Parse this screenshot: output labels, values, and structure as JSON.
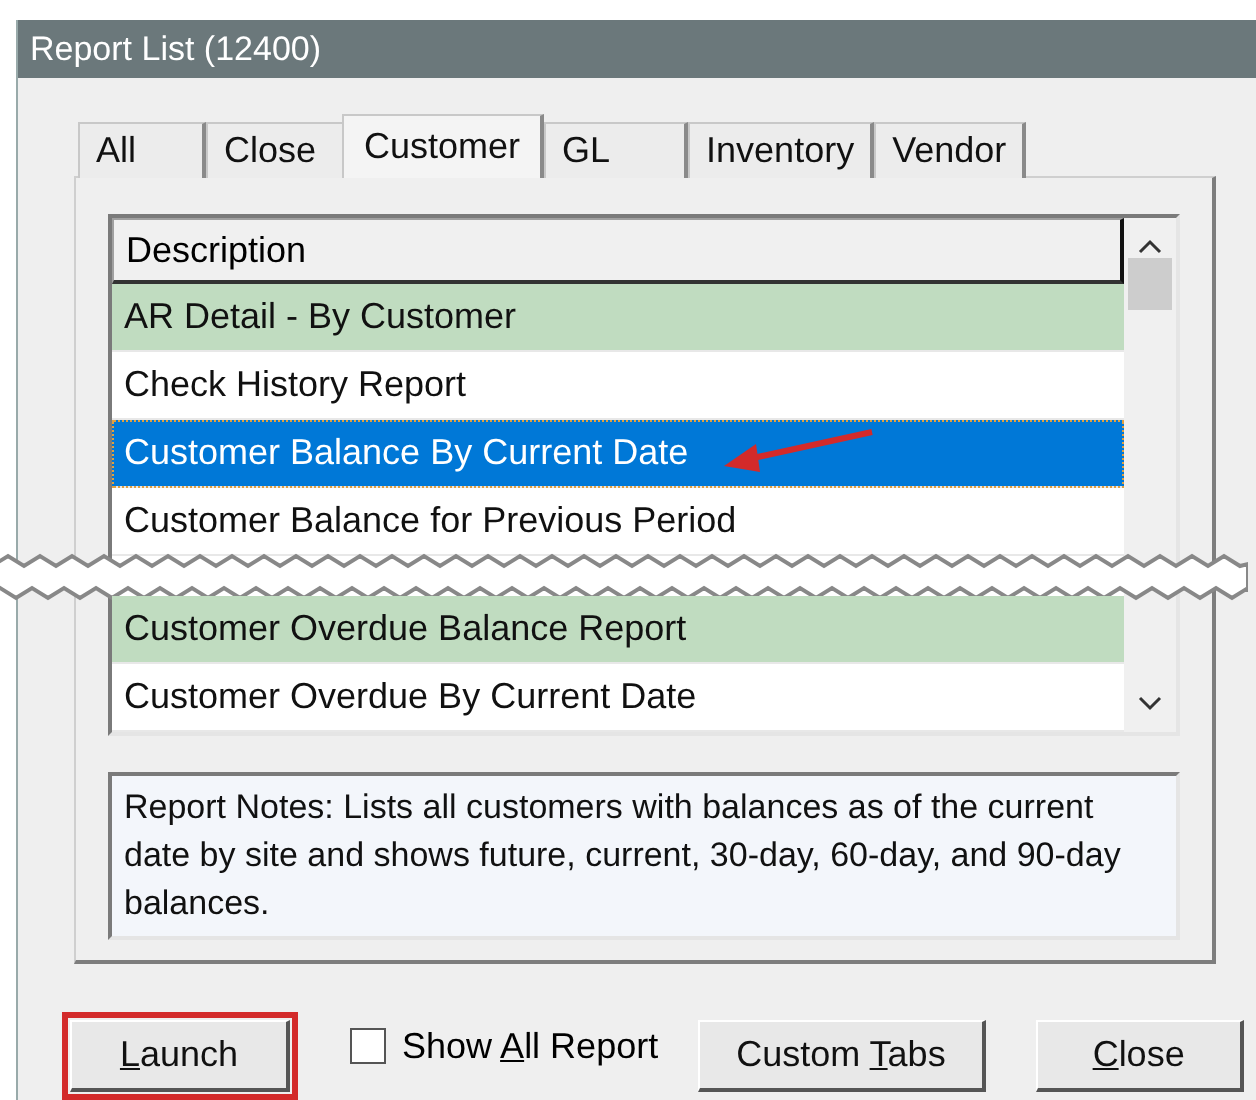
{
  "window": {
    "title": "Report List (12400)"
  },
  "tabs": [
    {
      "label": "All",
      "selected": false
    },
    {
      "label": "Close",
      "selected": false
    },
    {
      "label": "Customer",
      "selected": true
    },
    {
      "label": "GL",
      "selected": false
    },
    {
      "label": "Inventory",
      "selected": false
    },
    {
      "label": "Vendor",
      "selected": false
    }
  ],
  "list": {
    "header": "Description",
    "rows": [
      {
        "kind": "row",
        "text": "AR Detail - By Customer",
        "highlighted": true,
        "selected": false,
        "pointer": false
      },
      {
        "kind": "row",
        "text": "Check History Report",
        "highlighted": false,
        "selected": false,
        "pointer": false
      },
      {
        "kind": "row",
        "text": "Customer Balance By Current Date",
        "highlighted": false,
        "selected": true,
        "pointer": true
      },
      {
        "kind": "row",
        "text": "Customer Balance for Previous Period",
        "highlighted": false,
        "selected": false,
        "pointer": false
      },
      {
        "kind": "break"
      },
      {
        "kind": "row",
        "text": "Customer Overdue Balance Report",
        "highlighted": true,
        "selected": false,
        "pointer": false
      },
      {
        "kind": "row",
        "text": "Customer Overdue By Current Date",
        "highlighted": false,
        "selected": false,
        "pointer": false
      }
    ]
  },
  "notes": "Report Notes:  Lists all customers with balances as of the current date by site and shows future, current, 30-day, 60-day, and 90-day balances.",
  "launch_button": {
    "key": "L",
    "post": "aunch",
    "framed": true
  },
  "show_all": {
    "pre": "Show ",
    "key": "A",
    "post": "ll Report",
    "checked": false
  },
  "custom_tabs_button": {
    "pre": "Custom ",
    "key": "T",
    "post": "abs"
  },
  "close_button": {
    "key": "C",
    "post": "lose"
  }
}
